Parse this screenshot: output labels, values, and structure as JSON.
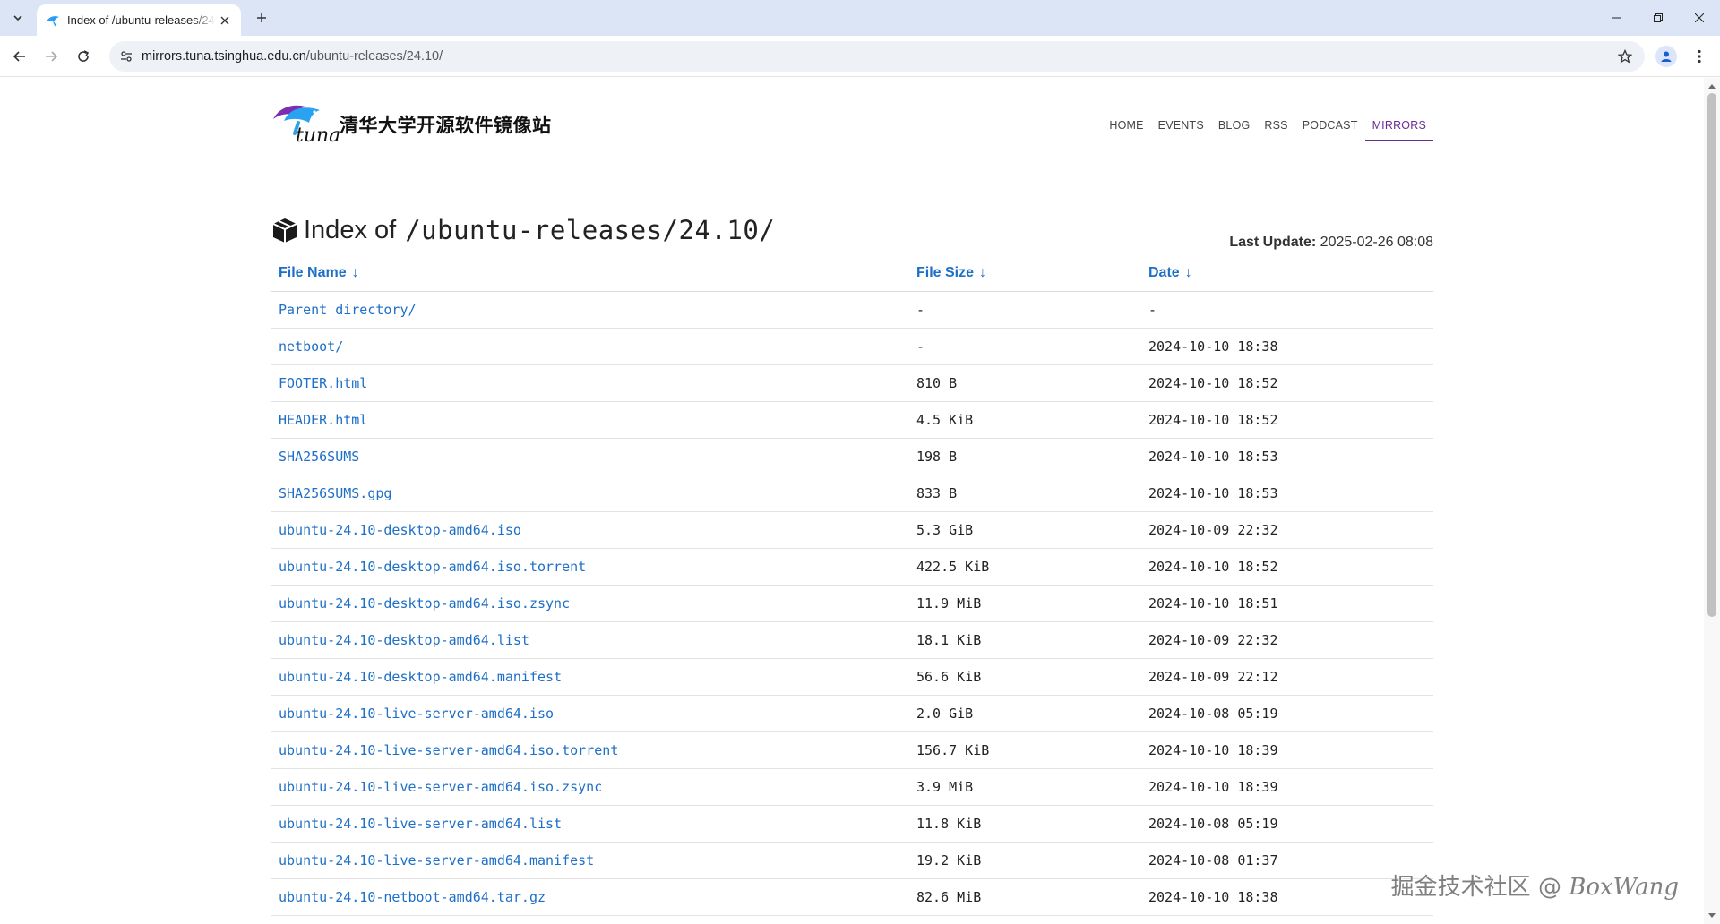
{
  "browser": {
    "tab_title": "Index of /ubuntu-releases/24.10/",
    "url_host": "mirrors.tuna.tsinghua.edu.cn",
    "url_path": "/ubuntu-releases/24.10/"
  },
  "site": {
    "name": "清华大学开源软件镜像站",
    "logo_text": "tuna",
    "nav": [
      {
        "label": "HOME"
      },
      {
        "label": "EVENTS"
      },
      {
        "label": "BLOG"
      },
      {
        "label": "RSS"
      },
      {
        "label": "PODCAST"
      },
      {
        "label": "MIRRORS",
        "active": true
      }
    ]
  },
  "page": {
    "title_prefix": "Index of",
    "title_path": "/ubuntu-releases/24.10/",
    "last_update_label": "Last Update:",
    "last_update_value": "2025-02-26 08:08"
  },
  "table": {
    "headers": {
      "name": "File Name",
      "size": "File Size",
      "date": "Date",
      "sort_arrow": "↓"
    },
    "rows": [
      {
        "name": "Parent directory/",
        "size": "-",
        "date": "-"
      },
      {
        "name": "netboot/",
        "size": "-",
        "date": "2024-10-10 18:38"
      },
      {
        "name": "FOOTER.html",
        "size": "810 B",
        "date": "2024-10-10 18:52"
      },
      {
        "name": "HEADER.html",
        "size": "4.5 KiB",
        "date": "2024-10-10 18:52"
      },
      {
        "name": "SHA256SUMS",
        "size": "198 B",
        "date": "2024-10-10 18:53"
      },
      {
        "name": "SHA256SUMS.gpg",
        "size": "833 B",
        "date": "2024-10-10 18:53"
      },
      {
        "name": "ubuntu-24.10-desktop-amd64.iso",
        "size": "5.3 GiB",
        "date": "2024-10-09 22:32"
      },
      {
        "name": "ubuntu-24.10-desktop-amd64.iso.torrent",
        "size": "422.5 KiB",
        "date": "2024-10-10 18:52"
      },
      {
        "name": "ubuntu-24.10-desktop-amd64.iso.zsync",
        "size": "11.9 MiB",
        "date": "2024-10-10 18:51"
      },
      {
        "name": "ubuntu-24.10-desktop-amd64.list",
        "size": "18.1 KiB",
        "date": "2024-10-09 22:32"
      },
      {
        "name": "ubuntu-24.10-desktop-amd64.manifest",
        "size": "56.6 KiB",
        "date": "2024-10-09 22:12"
      },
      {
        "name": "ubuntu-24.10-live-server-amd64.iso",
        "size": "2.0 GiB",
        "date": "2024-10-08 05:19"
      },
      {
        "name": "ubuntu-24.10-live-server-amd64.iso.torrent",
        "size": "156.7 KiB",
        "date": "2024-10-10 18:39"
      },
      {
        "name": "ubuntu-24.10-live-server-amd64.iso.zsync",
        "size": "3.9 MiB",
        "date": "2024-10-10 18:39"
      },
      {
        "name": "ubuntu-24.10-live-server-amd64.list",
        "size": "11.8 KiB",
        "date": "2024-10-08 05:19"
      },
      {
        "name": "ubuntu-24.10-live-server-amd64.manifest",
        "size": "19.2 KiB",
        "date": "2024-10-08 01:37"
      },
      {
        "name": "ubuntu-24.10-netboot-amd64.tar.gz",
        "size": "82.6 MiB",
        "date": "2024-10-10 18:38"
      }
    ]
  },
  "watermark": {
    "cjk": "掘金技术社区",
    "at": " @ ",
    "latin": "BoxWang"
  },
  "colors": {
    "link": "#1e6fc7",
    "nav_active": "#6a2c91",
    "chrome_bg": "#dbe5f5"
  }
}
